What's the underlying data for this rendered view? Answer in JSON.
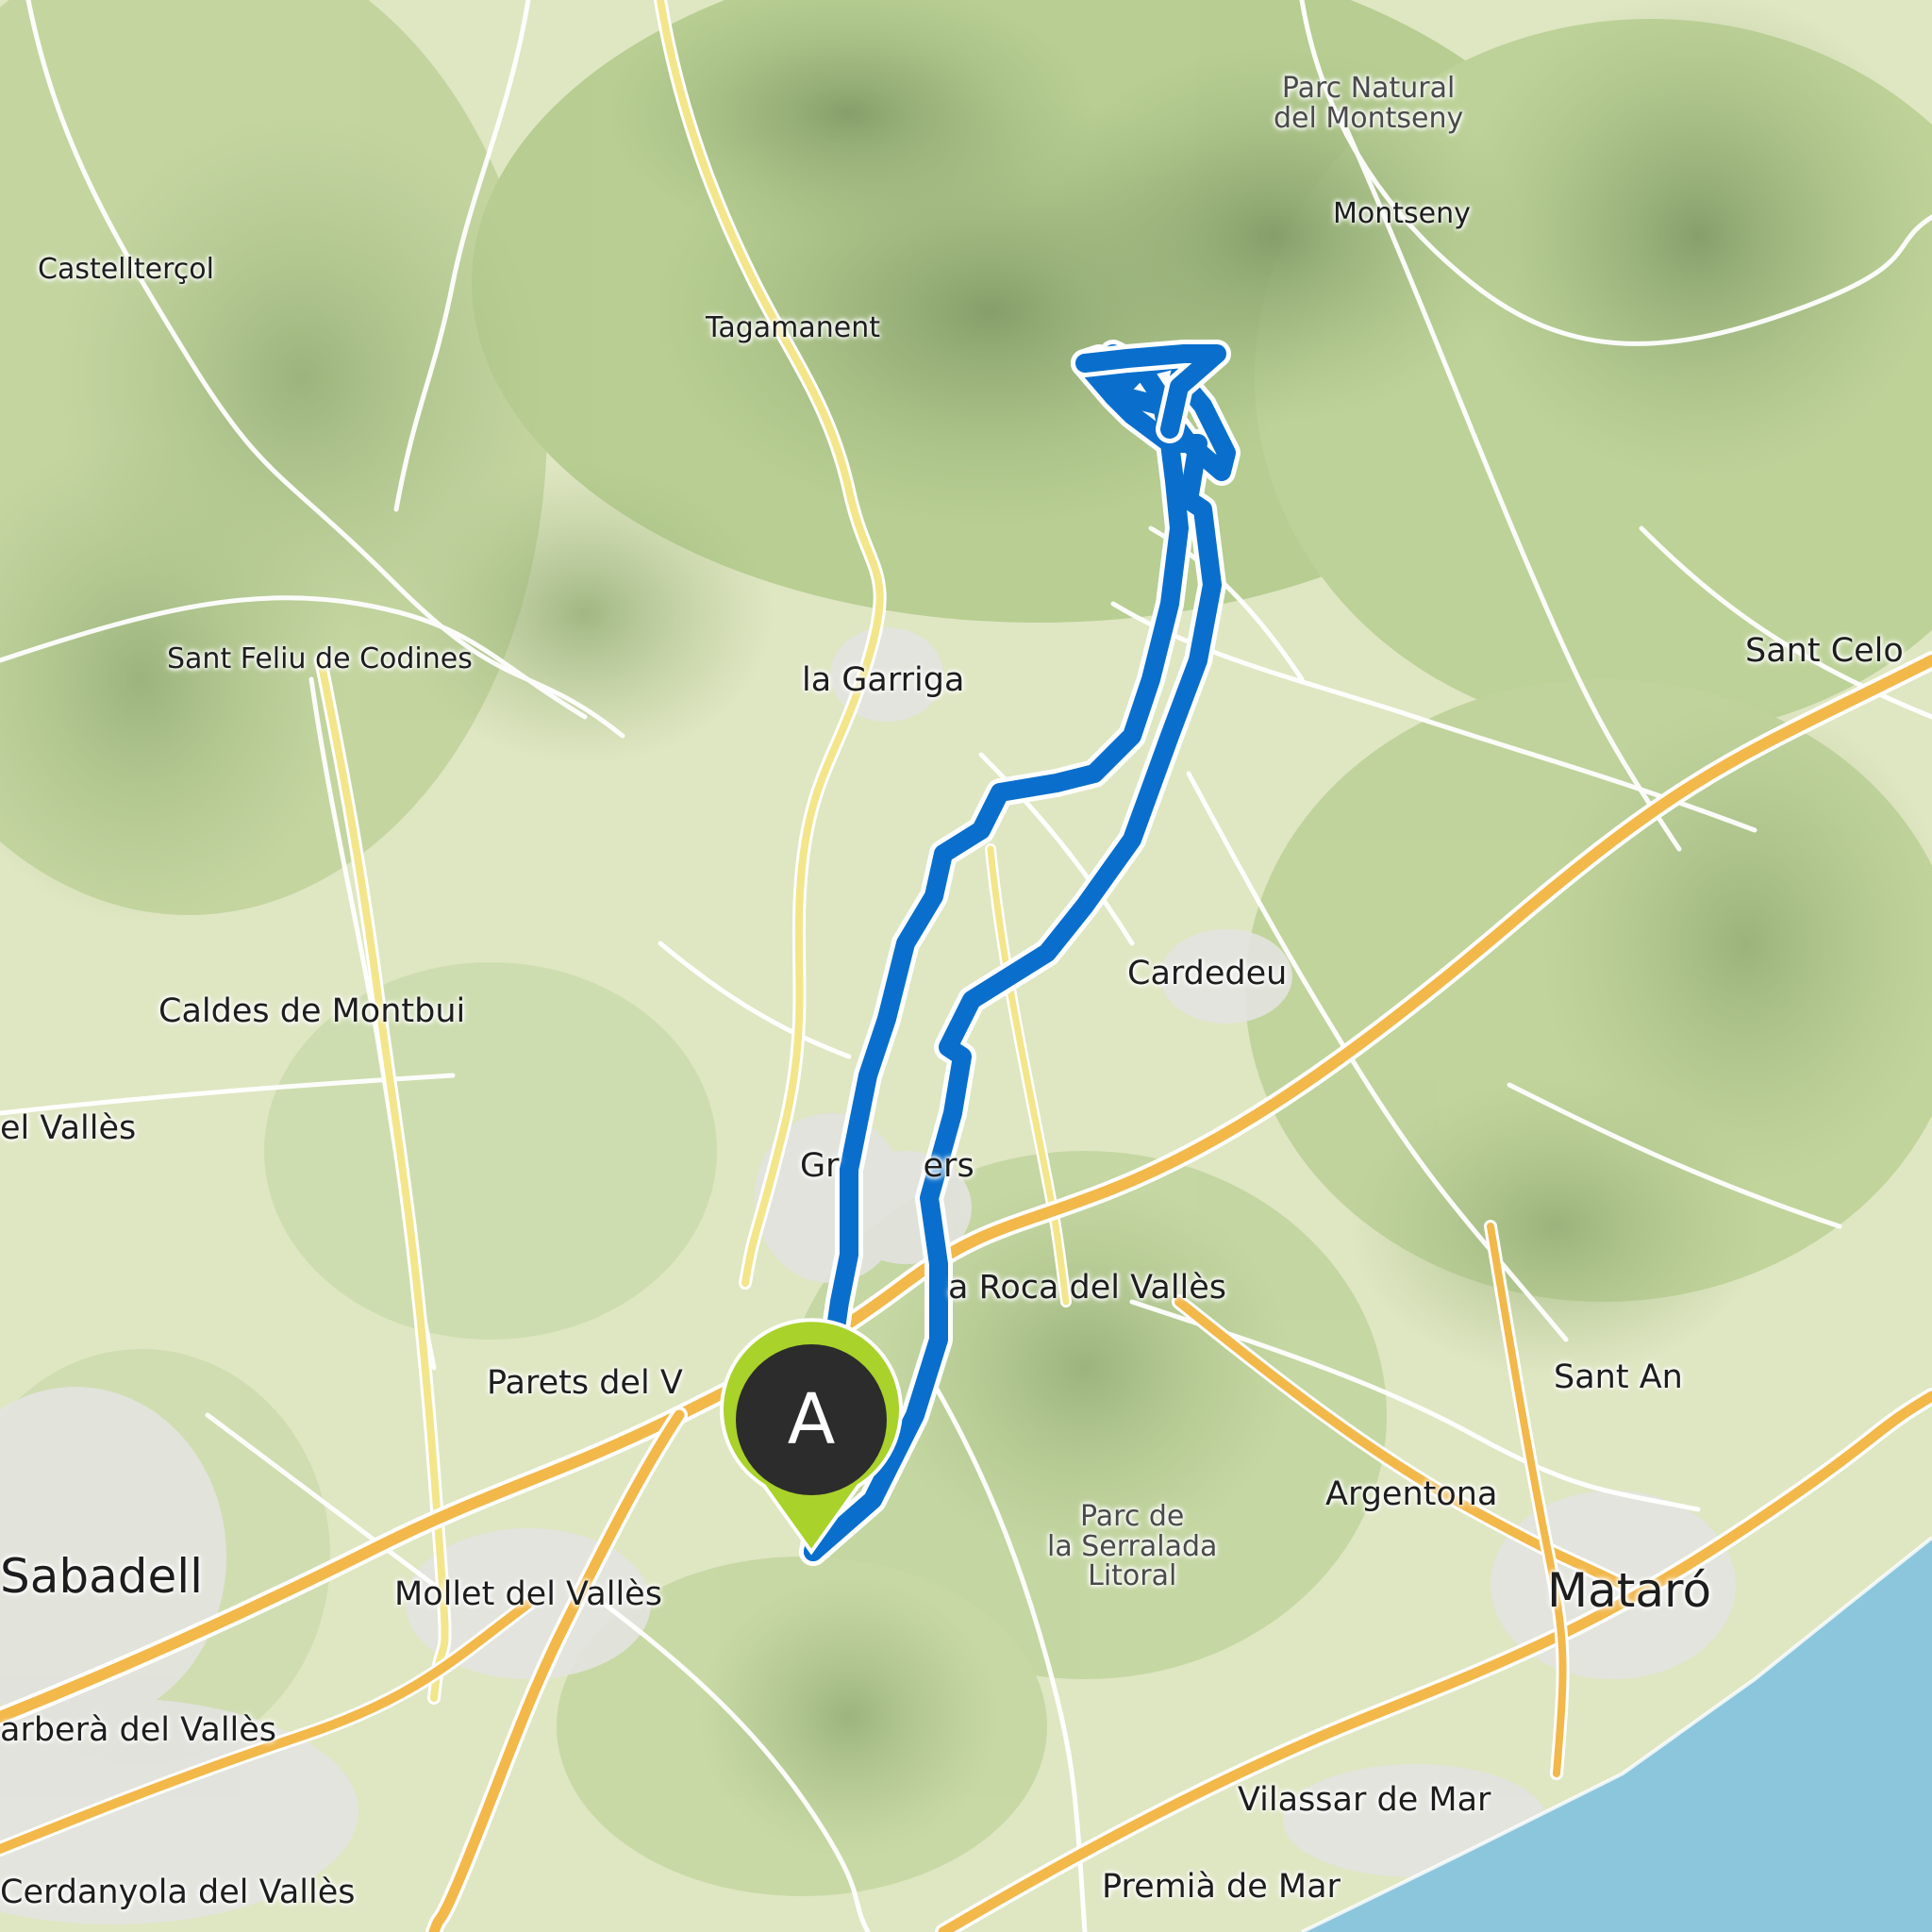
{
  "map": {
    "colors": {
      "land": "#dfe6c2",
      "forest": "#b5cc8f",
      "mountain_shade": "#8fa873",
      "urban": "#e3e3e0",
      "water": "#8cc6dc",
      "road_major": "#f2b84a",
      "road_secondary": "#f3e58a",
      "road_minor": "#ffffff",
      "route": "#0a6fcc",
      "marker_fill": "#2c2c2c",
      "marker_ring": "#a9d22a"
    },
    "route_marker": {
      "letter": "A",
      "icon": "map-pin-icon"
    },
    "places": {
      "parc_montseny": "Parc Natural\ndel Montseny",
      "montseny": "Montseny",
      "castellterol": "Castellterçol",
      "tagamanent": "Tagamanent",
      "sant_feliu": "Sant Feliu de Codines",
      "la_garriga": "la Garriga",
      "sant_celoni": "Sant Celo",
      "caldes": "Caldes de Montbui",
      "cardedeu": "Cardedeu",
      "del_valles": "el Vallès",
      "granollers": "Gr        ers",
      "la_roca": "a Roca del Vallès",
      "parets": "Parets del V",
      "sant_andreu": "Sant An",
      "parc_serralada": "Parc de\nla Serralada\nLitoral",
      "argentona": "Argentona",
      "sabadell": "Sabadell",
      "mollet": "Mollet del Vallès",
      "mataro": "Mataró",
      "barbera": "arberà del Vallès",
      "vilassar": "Vilassar de Mar",
      "cerdanyola": "Cerdanyola del Vallès",
      "premia": "Premià de Mar"
    }
  }
}
